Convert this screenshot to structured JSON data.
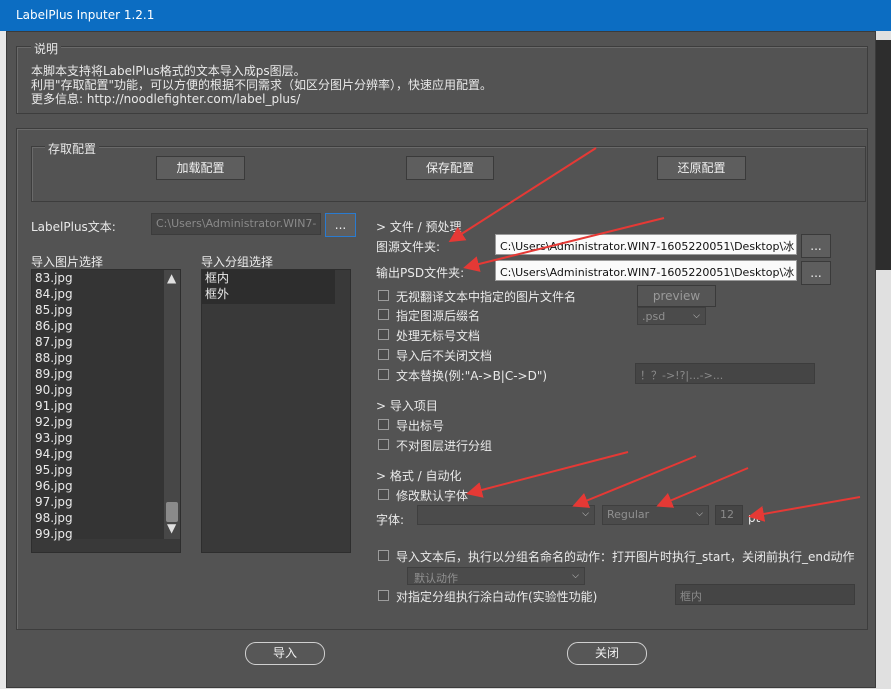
{
  "window": {
    "title": "LabelPlus Inputer 1.2.1"
  },
  "info": {
    "legend": "说明",
    "lines": [
      "本脚本支持将LabelPlus格式的文本导入成ps图层。",
      "利用\"存取配置\"功能，可以方便的根据不同需求（如区分图片分辨率），快速应用配置。",
      "更多信息: http://noodlefighter.com/label_plus/"
    ]
  },
  "config": {
    "legend": "存取配置",
    "load_label": "加载配置",
    "save_label": "保存配置",
    "restore_label": "还原配置"
  },
  "labelplus": {
    "label": "LabelPlus文本:",
    "path": "C:\\Users\\Administrator.WIN7-",
    "browse_label": "..."
  },
  "images": {
    "label": "导入图片选择",
    "items": [
      "83.jpg",
      "84.jpg",
      "85.jpg",
      "86.jpg",
      "87.jpg",
      "88.jpg",
      "89.jpg",
      "90.jpg",
      "91.jpg",
      "92.jpg",
      "93.jpg",
      "94.jpg",
      "95.jpg",
      "96.jpg",
      "97.jpg",
      "98.jpg",
      "99.jpg"
    ],
    "scroll_up": "▲",
    "scroll_down": "▼"
  },
  "groups": {
    "label": "导入分组选择",
    "items": [
      "框内",
      "框外"
    ]
  },
  "file_section": {
    "header": "> 文件 / 预处理",
    "source_label": "图源文件夹:",
    "source_path": "C:\\Users\\Administrator.WIN7-1605220051\\Desktop\\冰",
    "output_label": "输出PSD文件夹:",
    "output_path": "C:\\Users\\Administrator.WIN7-1605220051\\Desktop\\冰",
    "browse_label": "...",
    "options": [
      "无视翻译文本中指定的图片文件名",
      "指定图源后缀名",
      "处理无标号文档",
      "导入后不关闭文档",
      "文本替换(例:\"A->B|C->D\")"
    ],
    "preview_label": "preview",
    "suffix_value": ".psd",
    "replace_value": "！？->!?|...->..."
  },
  "import_section": {
    "header": "> 导入项目",
    "options": [
      "导出标号",
      "不对图层进行分组"
    ]
  },
  "format_section": {
    "header": "> 格式 / 自动化",
    "modify_font_label": "修改默认字体",
    "font_label": "字体:",
    "font_value": "",
    "style_value": "Regular",
    "size_value": "12",
    "size_unit": "pt",
    "action_label": "导入文本后，执行以分组名命名的动作：打开图片时执行_start，关闭前执行_end动作",
    "default_action": "默认动作",
    "whiteout_label": "对指定分组执行涂白动作(实验性功能)",
    "whiteout_value": "框内"
  },
  "footer": {
    "import_label": "导入",
    "close_label": "关闭"
  },
  "colors": {
    "titlebar": "#0c6dc2",
    "window_bg": "#535353",
    "annotation_arrow": "#e53935"
  }
}
